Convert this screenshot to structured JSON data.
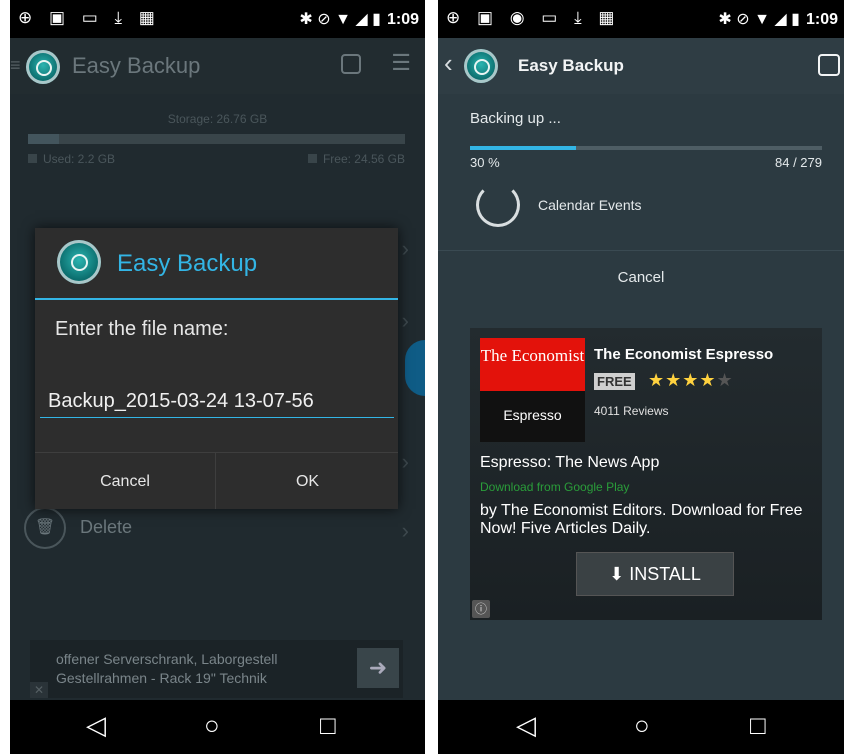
{
  "left": {
    "status_icons_left": "⊕ ▣ ▭ ⤓ ▦",
    "status_icons_right": "✱ ⊘ ▼ ◢ ▮",
    "status_time": "1:09",
    "app_title": "Easy Backup",
    "storage_label": "Storage: 26.76 GB",
    "used_label": "Used: 2.2 GB",
    "free_label": "Free: 24.56 GB",
    "storage_used_fraction": 0.082,
    "delete_label": "Delete",
    "dialog": {
      "title": "Easy Backup",
      "message": "Enter the file name:",
      "filename": "Backup_2015-03-24 13-07-56",
      "cancel": "Cancel",
      "ok": "OK"
    },
    "ad_banner": {
      "line1": "offener Serverschrank, Laborgestell",
      "line2": "Gestellrahmen - Rack 19\" Technik",
      "arrow": "➜",
      "close": "✕"
    }
  },
  "right": {
    "status_icons_left": "⊕ ▣ ◉ ▭ ⤓ ▦",
    "status_icons_right": "✱ ⊘ ▼ ◢ ▮",
    "status_time": "1:09",
    "app_title": "Easy Backup",
    "progress_title": "Backing up ...",
    "progress_percent": "30 %",
    "progress_fraction": 0.3,
    "progress_count": "84 / 279",
    "current_task": "Calendar Events",
    "cancel": "Cancel",
    "ad": {
      "logo_top": "The Economist",
      "logo_bottom": "Espresso",
      "app_name": "The Economist Espresso",
      "price_badge": "FREE",
      "stars_filled": "★★★★",
      "stars_empty": "★",
      "rating": 4,
      "reviews": "4011 Reviews",
      "headline": "Espresso: The News App",
      "download_text": "Download from Google Play",
      "body": "by The Economist Editors. Download for Free Now! Five Articles Daily.",
      "install": "⬇  INSTALL",
      "info": "ⓘ"
    }
  },
  "nav": {
    "back": "◁",
    "home": "○",
    "recents": "□"
  },
  "colors": {
    "accent": "#33b5e5",
    "background": "#263238",
    "dialog": "#2d2d2d"
  }
}
